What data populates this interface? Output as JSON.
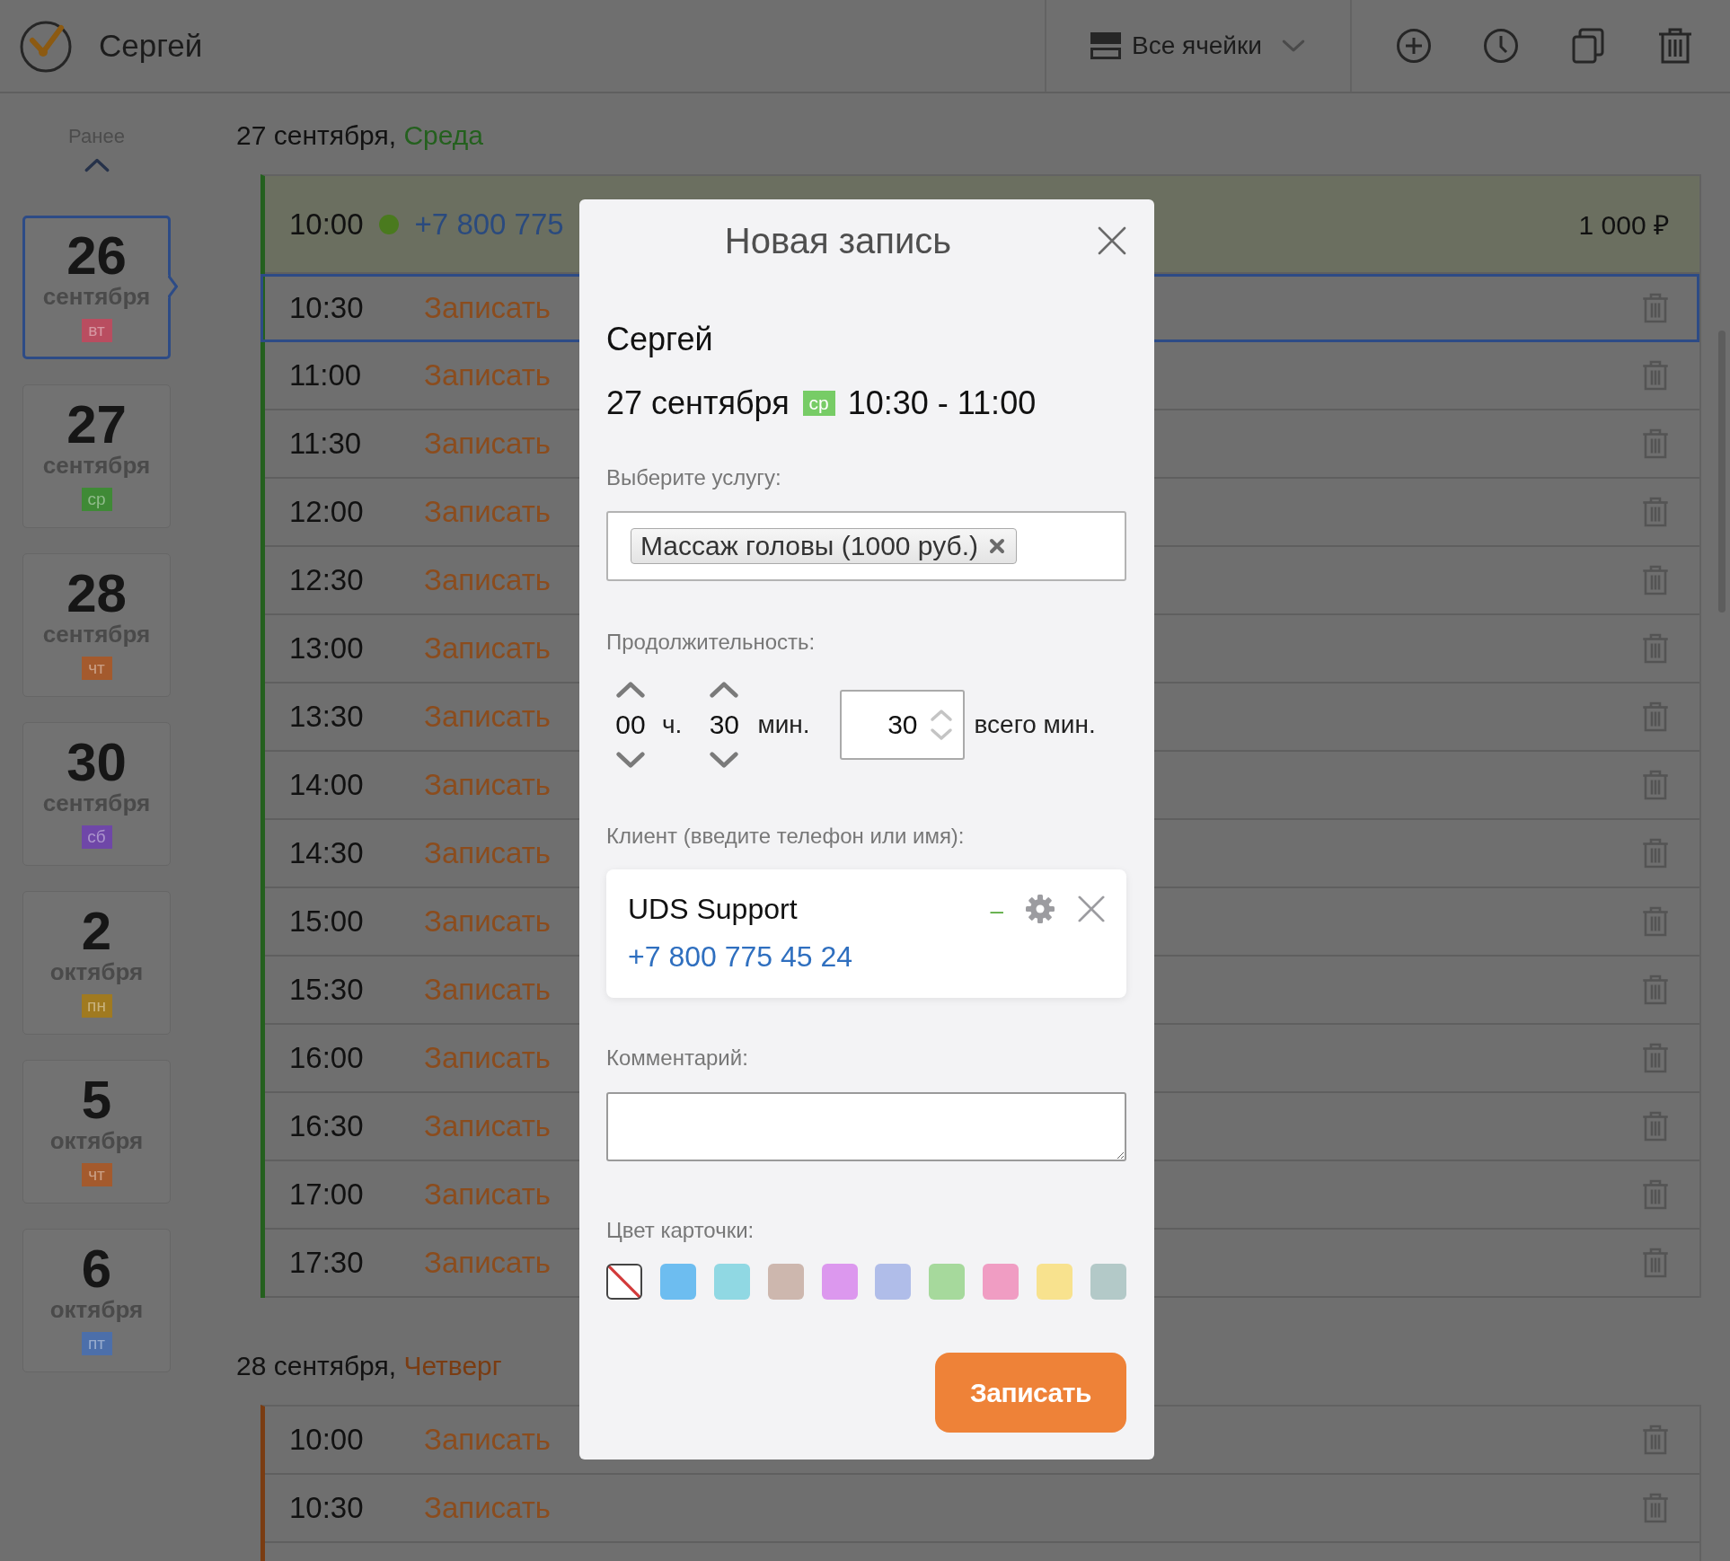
{
  "topbar": {
    "user_name": "Сергей",
    "cells_filter": "Все ячейки"
  },
  "sidebar": {
    "earlier": "Ранее",
    "dates": [
      {
        "day": "26",
        "month": "сентября",
        "weekday": "вт",
        "color": "#b94d60",
        "selected": true
      },
      {
        "day": "27",
        "month": "сентября",
        "weekday": "ср",
        "color": "#3f8a36",
        "selected": false
      },
      {
        "day": "28",
        "month": "сентября",
        "weekday": "чт",
        "color": "#a45a2d",
        "selected": false
      },
      {
        "day": "30",
        "month": "сентября",
        "weekday": "сб",
        "color": "#6f47a8",
        "selected": false
      },
      {
        "day": "2",
        "month": "октября",
        "weekday": "пн",
        "color": "#a07a20",
        "selected": false
      },
      {
        "day": "5",
        "month": "октября",
        "weekday": "чт",
        "color": "#a45a2d",
        "selected": false
      },
      {
        "day": "6",
        "month": "октября",
        "weekday": "пт",
        "color": "#4c6faa",
        "selected": false
      }
    ]
  },
  "schedule": [
    {
      "date": "27 сентября,",
      "weekday": "Среда",
      "color": "#24601e",
      "slots": [
        {
          "kind": "booked",
          "time": "10:00",
          "client_phone": "+7 800 775",
          "price": "1 000 ₽",
          "selected": false
        },
        {
          "kind": "free",
          "time": "10:30",
          "action": "Записать",
          "selected": true
        },
        {
          "kind": "free",
          "time": "11:00",
          "action": "Записать",
          "selected": false
        },
        {
          "kind": "free",
          "time": "11:30",
          "action": "Записать",
          "selected": false
        },
        {
          "kind": "free",
          "time": "12:00",
          "action": "Записать",
          "selected": false
        },
        {
          "kind": "free",
          "time": "12:30",
          "action": "Записать",
          "selected": false
        },
        {
          "kind": "free",
          "time": "13:00",
          "action": "Записать",
          "selected": false
        },
        {
          "kind": "free",
          "time": "13:30",
          "action": "Записать",
          "selected": false
        },
        {
          "kind": "free",
          "time": "14:00",
          "action": "Записать",
          "selected": false
        },
        {
          "kind": "free",
          "time": "14:30",
          "action": "Записать",
          "selected": false
        },
        {
          "kind": "free",
          "time": "15:00",
          "action": "Записать",
          "selected": false
        },
        {
          "kind": "free",
          "time": "15:30",
          "action": "Записать",
          "selected": false
        },
        {
          "kind": "free",
          "time": "16:00",
          "action": "Записать",
          "selected": false
        },
        {
          "kind": "free",
          "time": "16:30",
          "action": "Записать",
          "selected": false
        },
        {
          "kind": "free",
          "time": "17:00",
          "action": "Записать",
          "selected": false
        },
        {
          "kind": "free",
          "time": "17:30",
          "action": "Записать",
          "selected": false
        }
      ]
    },
    {
      "date": "28 сентября,",
      "weekday": "Четверг",
      "color": "#7a3c12",
      "slots": [
        {
          "kind": "free",
          "time": "10:00",
          "action": "Записать",
          "selected": false
        },
        {
          "kind": "free",
          "time": "10:30",
          "action": "Записать",
          "selected": false
        }
      ]
    }
  ],
  "modal": {
    "title": "Новая запись",
    "master": "Сергей",
    "date": "27 сентября",
    "weekday": "ср",
    "time_range": "10:30 - 11:00",
    "service": {
      "label": "Выберите услугу:",
      "tags": [
        "Массаж головы (1000 руб.)"
      ]
    },
    "duration": {
      "label": "Продолжительность:",
      "hours": "00",
      "hours_unit": "ч.",
      "minutes": "30",
      "minutes_unit": "мин.",
      "total": "30",
      "total_unit": "всего мин."
    },
    "client": {
      "label": "Клиент (введите телефон или имя):",
      "name": "UDS Support",
      "status": "–",
      "phone": "+7 800 775 45 24"
    },
    "comment": {
      "label": "Комментарий:"
    },
    "card_color": {
      "label": "Цвет карточки:",
      "swatches": [
        {
          "kind": "none",
          "selected": true
        },
        {
          "kind": "color",
          "color": "#6dbdf0",
          "selected": false
        },
        {
          "kind": "color",
          "color": "#90d8e3",
          "selected": false
        },
        {
          "kind": "color",
          "color": "#cdb7ae",
          "selected": false
        },
        {
          "kind": "color",
          "color": "#dc98ee",
          "selected": false
        },
        {
          "kind": "color",
          "color": "#b0bde9",
          "selected": false
        },
        {
          "kind": "color",
          "color": "#a6d99c",
          "selected": false
        },
        {
          "kind": "color",
          "color": "#f09dc3",
          "selected": false
        },
        {
          "kind": "color",
          "color": "#f8e28e",
          "selected": false
        },
        {
          "kind": "color",
          "color": "#b3c9c8",
          "selected": false
        }
      ]
    },
    "submit": "Записать"
  }
}
